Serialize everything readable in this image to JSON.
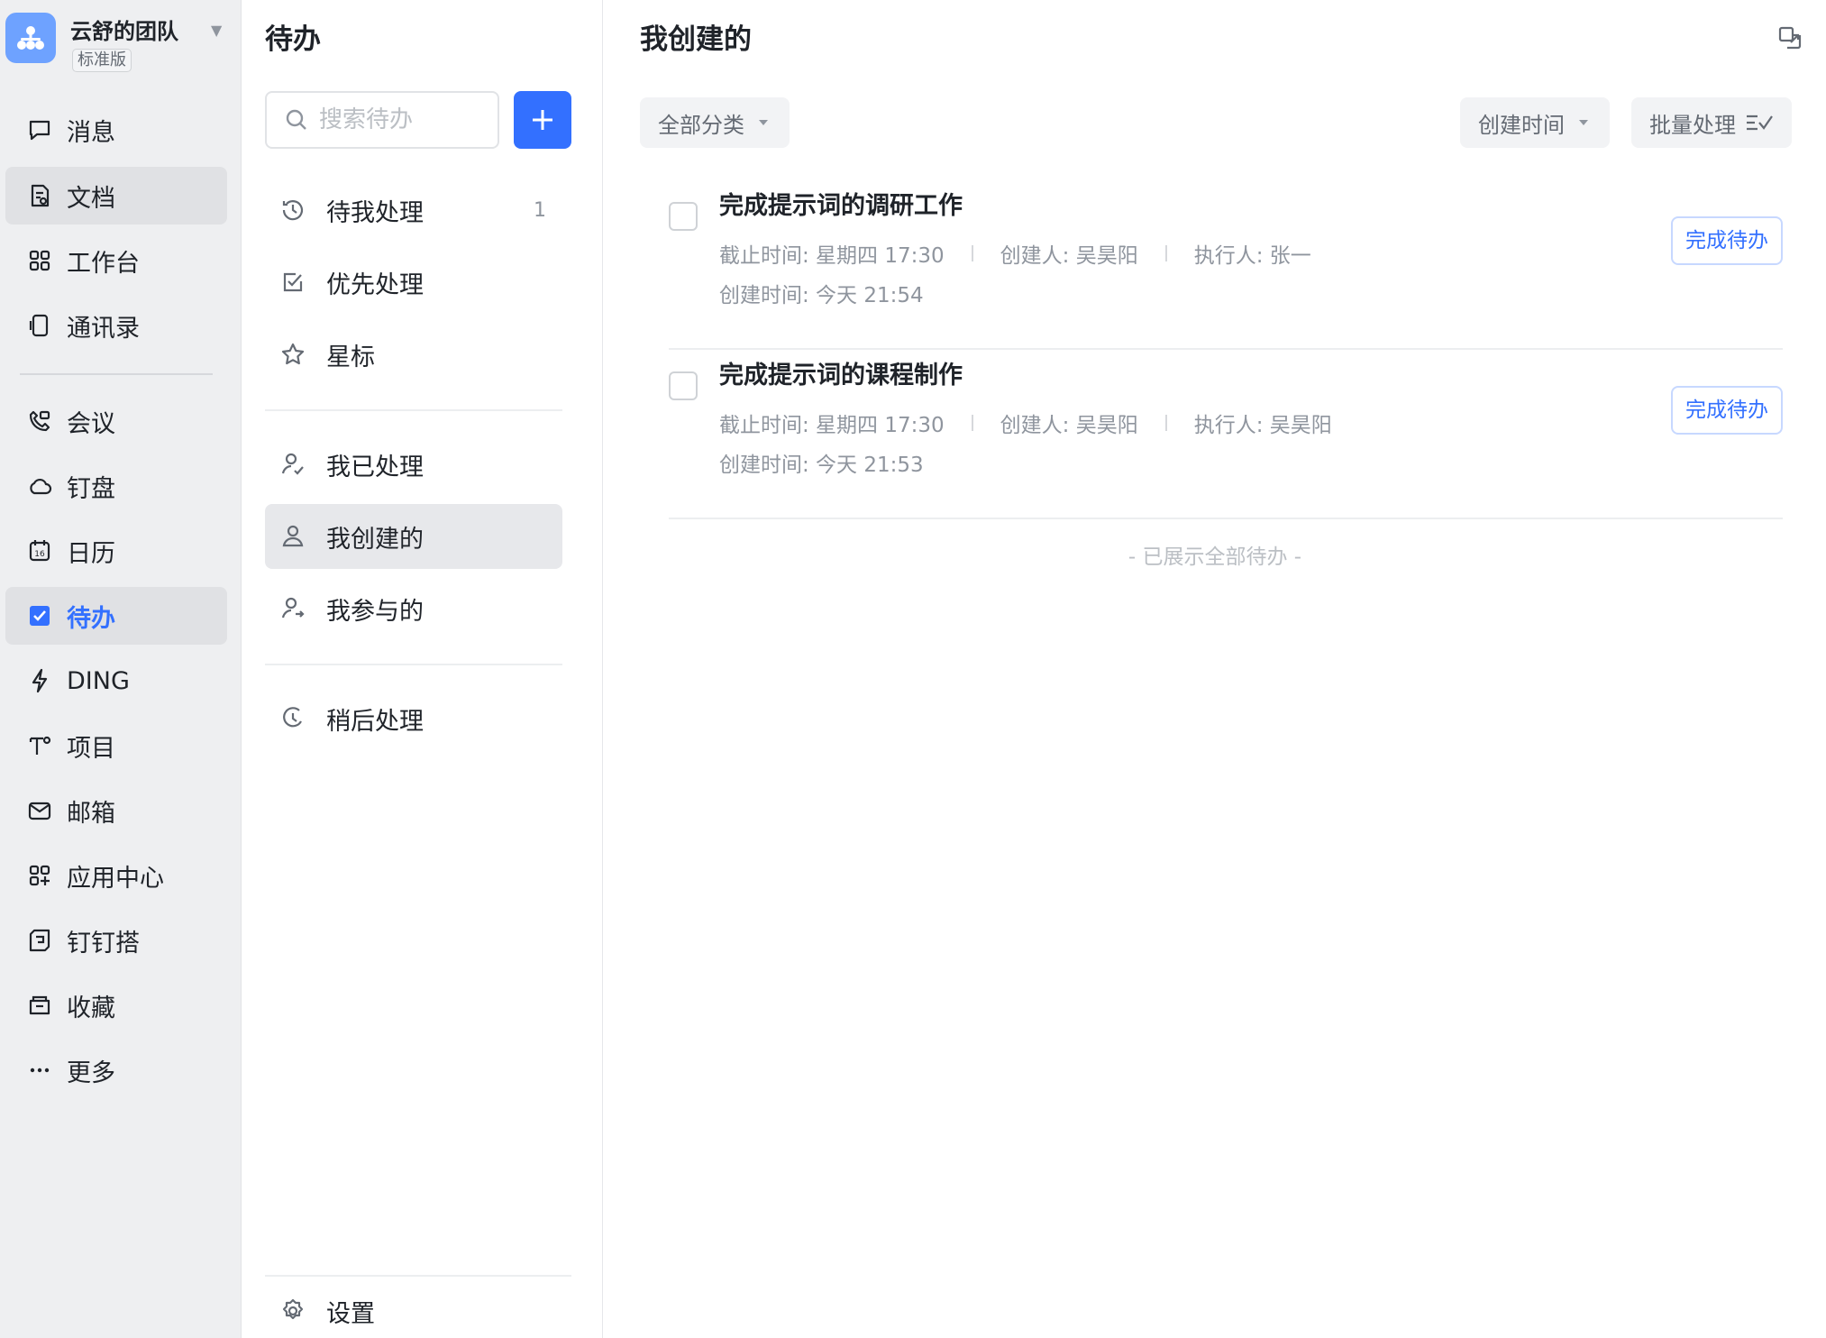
{
  "sidebar": {
    "team": {
      "name": "云舒的团队",
      "badge": "标准版"
    },
    "items": [
      {
        "label": "消息",
        "icon": "message-icon"
      },
      {
        "label": "文档",
        "icon": "document-icon"
      },
      {
        "label": "工作台",
        "icon": "workbench-icon"
      },
      {
        "label": "通讯录",
        "icon": "contacts-icon"
      },
      {
        "label": "会议",
        "icon": "meeting-icon"
      },
      {
        "label": "钉盘",
        "icon": "cloud-drive-icon"
      },
      {
        "label": "日历",
        "icon": "calendar-icon"
      },
      {
        "label": "待办",
        "icon": "todo-icon"
      },
      {
        "label": "DING",
        "icon": "ding-icon"
      },
      {
        "label": "项目",
        "icon": "project-icon"
      },
      {
        "label": "邮箱",
        "icon": "mail-icon"
      },
      {
        "label": "应用中心",
        "icon": "app-center-icon"
      },
      {
        "label": "钉钉搭",
        "icon": "dingtalk-builder-icon"
      },
      {
        "label": "收藏",
        "icon": "favorites-icon"
      },
      {
        "label": "更多",
        "icon": "more-icon"
      }
    ]
  },
  "todo_panel": {
    "title": "待办",
    "search": {
      "placeholder": "搜索待办"
    },
    "filters": [
      {
        "label": "待我处理",
        "count": "1"
      },
      {
        "label": "优先处理"
      },
      {
        "label": "星标"
      },
      {
        "label": "我已处理"
      },
      {
        "label": "我创建的"
      },
      {
        "label": "我参与的"
      },
      {
        "label": "稍后处理"
      }
    ],
    "settings_label": "设置"
  },
  "main": {
    "title": "我创建的",
    "category_filter": "全部分类",
    "sort_label": "创建时间",
    "batch_label": "批量处理",
    "tasks": [
      {
        "title": "完成提示词的调研工作",
        "deadline": "截止时间: 星期四 17:30",
        "creator": "创建人: 吴昊阳",
        "assignee": "执行人: 张一",
        "created": "创建时间: 今天 21:54",
        "action": "完成待办"
      },
      {
        "title": "完成提示词的课程制作",
        "deadline": "截止时间: 星期四 17:30",
        "creator": "创建人: 吴昊阳",
        "assignee": "执行人: 吴昊阳",
        "created": "创建时间: 今天 21:53",
        "action": "完成待办"
      }
    ],
    "end_note": "- 已展示全部待办 -"
  },
  "colors": {
    "accent": "#3370ff",
    "sidebar_bg": "#eeeff1",
    "text": "#1f2329",
    "muted": "#8f959e"
  }
}
